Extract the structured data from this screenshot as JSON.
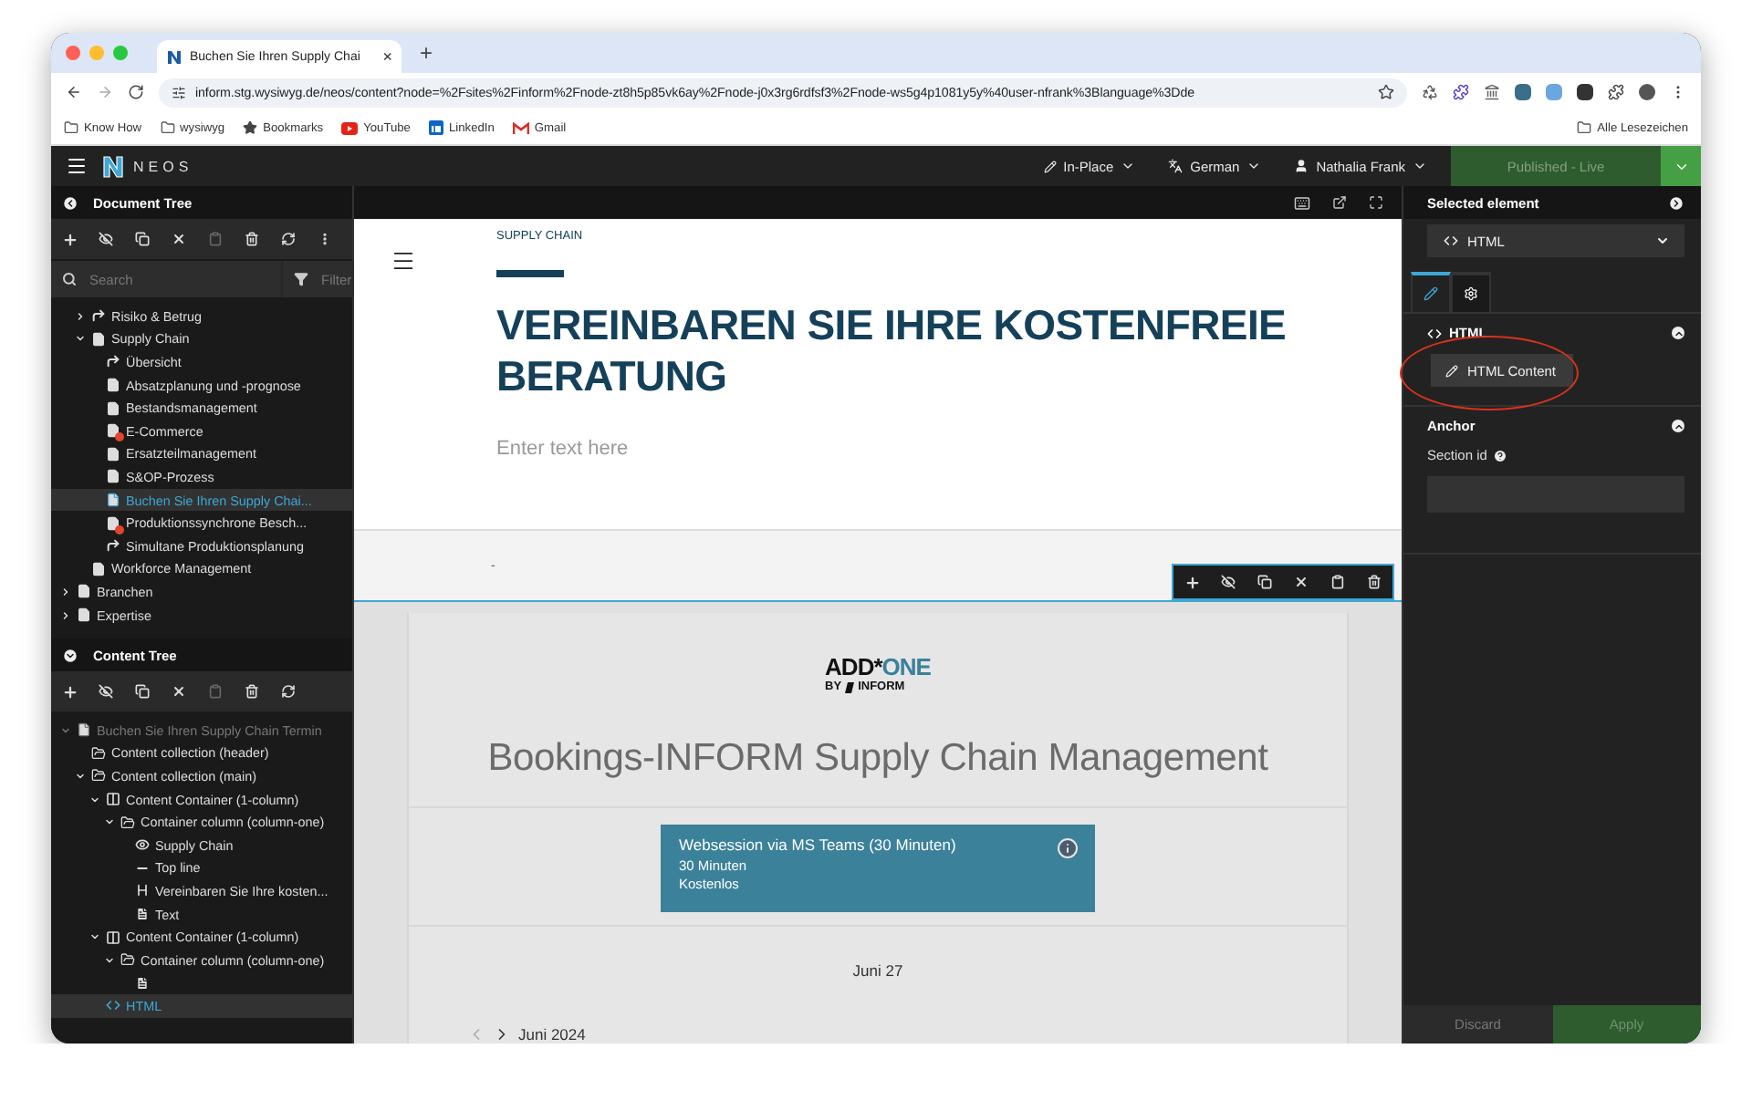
{
  "browser": {
    "tab_title": "Buchen Sie Ihren Supply Chai",
    "tab_close": "×",
    "new_tab": "+",
    "url": "inform.stg.wysiwyg.de/neos/content?node=%2Fsites%2Finform%2Fnode-zt8h5p85vk6ay%2Fnode-j0x3rg6rdfsf3%2Fnode-ws5g4p1081y5y%40user-nfrank%3Blanguage%3Dde",
    "bookmarks": [
      {
        "label": "Know How",
        "kind": "folder"
      },
      {
        "label": "wysiwyg",
        "kind": "folder"
      },
      {
        "label": "Bookmarks",
        "kind": "star"
      },
      {
        "label": "YouTube",
        "kind": "youtube"
      },
      {
        "label": "LinkedIn",
        "kind": "linkedin"
      },
      {
        "label": "Gmail",
        "kind": "gmail"
      }
    ],
    "all_bookmarks": "Alle Lesezeichen"
  },
  "neos_bar": {
    "brand": "NEOS",
    "edit_mode": "In-Place",
    "language": "German",
    "user": "Nathalia Frank",
    "publish": "Published - Live"
  },
  "document_tree": {
    "title": "Document Tree",
    "toolbar": [
      {
        "kind": "add",
        "disabled": false
      },
      {
        "kind": "hide",
        "disabled": false
      },
      {
        "kind": "copy",
        "disabled": false
      },
      {
        "kind": "cut",
        "disabled": false
      },
      {
        "kind": "paste",
        "disabled": true
      },
      {
        "kind": "delete",
        "disabled": false
      },
      {
        "kind": "refresh",
        "disabled": false
      },
      {
        "kind": "more",
        "disabled": false
      }
    ],
    "search_placeholder": "Search",
    "filter_placeholder": "Filter",
    "items": [
      {
        "children": [
          {
            "label": "Risiko & Betrug",
            "kind": "shortcut",
            "expanded": false,
            "selected": false
          },
          {
            "label": "Supply Chain",
            "kind": "page",
            "expanded": true,
            "selected": false,
            "children": [
              {
                "label": "Übersicht",
                "kind": "shortcut",
                "selected": false
              },
              {
                "label": "Absatzplanung und -prognose",
                "kind": "page",
                "selected": false
              },
              {
                "label": "Bestandsmanagement",
                "kind": "page",
                "selected": false
              },
              {
                "label": "E-Commerce",
                "kind": "hidden",
                "selected": false
              },
              {
                "label": "Ersatzteilmanagement",
                "kind": "page",
                "selected": false
              },
              {
                "label": "S&OP-Prozess",
                "kind": "page",
                "selected": false
              },
              {
                "label": "Buchen Sie Ihren Supply Chai...",
                "kind": "page",
                "selected": true
              },
              {
                "label": "Produktionssynchrone Besch...",
                "kind": "hidden",
                "selected": false
              },
              {
                "label": "Simultane Produktionsplanung",
                "kind": "shortcut",
                "selected": false
              }
            ]
          },
          {
            "label": "Workforce Management",
            "kind": "page",
            "selected": false
          }
        ]
      },
      {
        "label": "Branchen",
        "kind": "page",
        "expanded": false,
        "selected": false
      },
      {
        "label": "Expertise",
        "kind": "page",
        "expanded": false,
        "selected": false
      }
    ]
  },
  "content_tree": {
    "title": "Content Tree",
    "toolbar": [
      {
        "kind": "add",
        "disabled": false
      },
      {
        "kind": "hide",
        "disabled": false
      },
      {
        "kind": "copy",
        "disabled": false
      },
      {
        "kind": "cut",
        "disabled": false
      },
      {
        "kind": "paste",
        "disabled": true
      },
      {
        "kind": "delete",
        "disabled": false
      },
      {
        "kind": "refresh",
        "disabled": false
      }
    ],
    "items": [
      {
        "label": "Buchen Sie Ihren Supply Chain Termin",
        "kind": "page",
        "expanded": true,
        "selected": false,
        "children": [
          {
            "label": "Content collection (header)",
            "kind": "folder",
            "selected": false
          },
          {
            "label": "Content collection (main)",
            "kind": "folder",
            "expanded": true,
            "selected": false,
            "children": [
              {
                "label": "Content Container (1-column)",
                "kind": "columns",
                "expanded": true,
                "selected": false,
                "children": [
                  {
                    "label": "Container column (column-one)",
                    "kind": "folder",
                    "expanded": true,
                    "selected": false,
                    "children": [
                      {
                        "label": "Supply Chain",
                        "kind": "eye",
                        "selected": false
                      },
                      {
                        "label": "Top line",
                        "kind": "line",
                        "selected": false
                      },
                      {
                        "label": "Vereinbaren Sie Ihre kosten...",
                        "kind": "heading",
                        "selected": false
                      },
                      {
                        "label": "Text",
                        "kind": "text",
                        "selected": false
                      }
                    ]
                  }
                ]
              },
              {
                "label": "Content Container (1-column)",
                "kind": "columns",
                "expanded": true,
                "selected": false,
                "children": [
                  {
                    "label": "Container column (column-one)",
                    "kind": "folder",
                    "expanded": true,
                    "selected": false,
                    "children": [
                      {
                        "kind": "text",
                        "selected": false
                      }
                    ]
                  }
                ]
              },
              {
                "label": "HTML",
                "kind": "code",
                "selected": true
              }
            ]
          }
        ]
      }
    ]
  },
  "page_preview": {
    "breadcrumb": "SUPPLY CHAIN",
    "heading": "VEREINBAREN SIE IHRE KOSTENFREIE BERATUNG",
    "text_placeholder": "Enter text here",
    "divider_mark": "-",
    "inline_toolbar": [
      {
        "kind": "add",
        "disabled": false
      },
      {
        "kind": "hide",
        "disabled": false
      },
      {
        "kind": "copy",
        "disabled": false
      },
      {
        "kind": "cut",
        "disabled": false
      },
      {
        "kind": "paste",
        "disabled": false
      },
      {
        "kind": "delete",
        "disabled": false
      }
    ],
    "booking": {
      "logo_main": "ADD*",
      "logo_accent": "ONE",
      "logo_by": "BY",
      "logo_brand": "INFORM",
      "title": "Bookings-INFORM Supply Chain Management",
      "service": {
        "name": "Websession via MS Teams (30 Minuten)",
        "duration": "30 Minuten",
        "price": "Kostenlos"
      },
      "date": "Juni 27",
      "month": "Juni 2024"
    }
  },
  "inspector": {
    "title": "Selected element",
    "element": "HTML",
    "tabs": [
      {
        "kind": "edit",
        "selected": true
      },
      {
        "kind": "settings",
        "selected": false
      }
    ],
    "sections": [
      {
        "kind": "html",
        "title": "HTML",
        "button": "HTML Content",
        "highlighted": true
      },
      {
        "kind": "anchor",
        "title": "Anchor",
        "field_label": "Section id"
      }
    ],
    "discard": "Discard",
    "apply": "Apply"
  }
}
